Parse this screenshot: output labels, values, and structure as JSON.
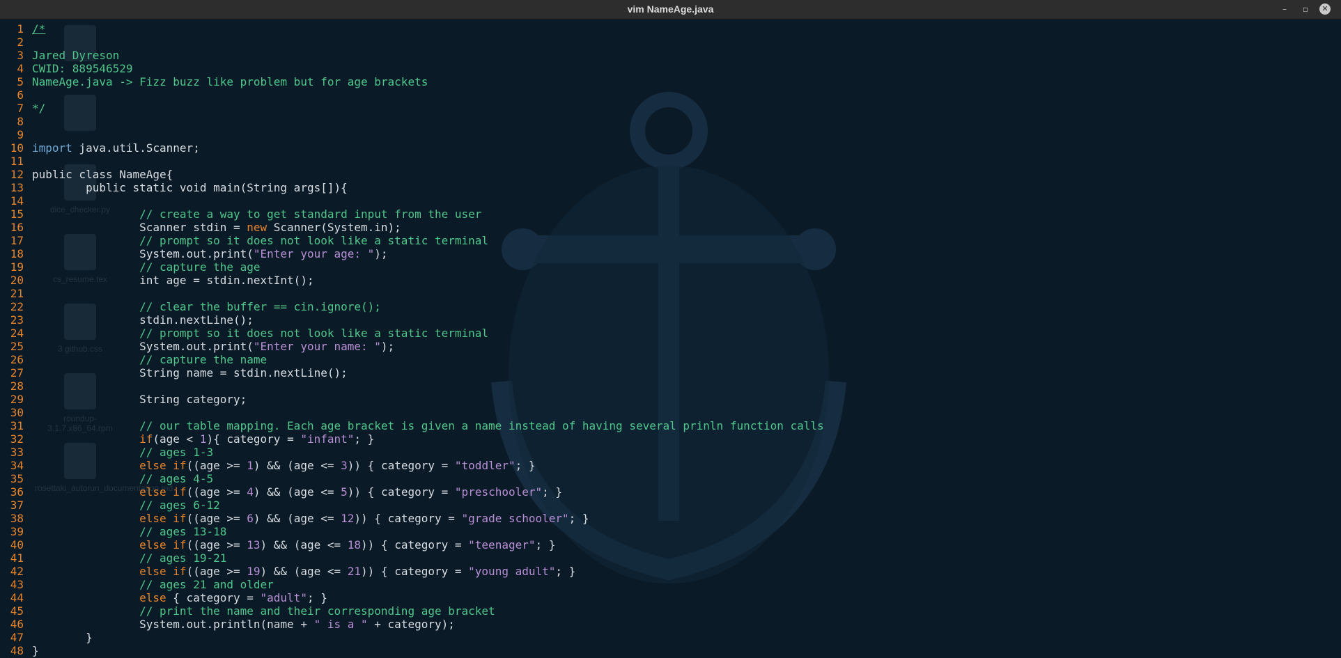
{
  "window": {
    "title": "vim NameAge.java",
    "controls": {
      "minimize": "–",
      "maximize": "▫",
      "close": "✕"
    }
  },
  "desktop_ghost_icons": [
    {
      "label": ""
    },
    {
      "label": ""
    },
    {
      "label": "dice_checker.py"
    },
    {
      "label": "cs_resume.tex"
    },
    {
      "label": "3 github.css"
    },
    {
      "label": "roundup-3.1.7.x86_64.rpm"
    },
    {
      "label": "rosettaki_autorun_documentation.md"
    }
  ],
  "colors": {
    "background": "#0b1a27",
    "line_number": "#e8852a",
    "comment": "#50c78a",
    "keyword": "#e8852a",
    "string": "#b98fd6",
    "text": "#d8dde2"
  },
  "code": [
    {
      "n": "1",
      "t": [
        [
          "c",
          "/*"
        ]
      ]
    },
    {
      "n": "2",
      "t": []
    },
    {
      "n": "3",
      "t": [
        [
          "c",
          "Jared Dyreson"
        ]
      ]
    },
    {
      "n": "4",
      "t": [
        [
          "c",
          "CWID: 889546529"
        ]
      ]
    },
    {
      "n": "5",
      "t": [
        [
          "c",
          "NameAge.java -> Fizz buzz like problem but for age brackets"
        ]
      ]
    },
    {
      "n": "6",
      "t": []
    },
    {
      "n": "7",
      "t": [
        [
          "c",
          "*/"
        ]
      ]
    },
    {
      "n": "8",
      "t": []
    },
    {
      "n": "9",
      "t": []
    },
    {
      "n": "10",
      "t": [
        [
          "imp",
          "import"
        ],
        [
          "src",
          " java.util.Scanner;"
        ]
      ]
    },
    {
      "n": "11",
      "t": []
    },
    {
      "n": "12",
      "t": [
        [
          "src",
          "public class NameAge{"
        ]
      ]
    },
    {
      "n": "13",
      "t": [
        [
          "src",
          "        public static void main(String args[]){"
        ]
      ]
    },
    {
      "n": "14",
      "t": []
    },
    {
      "n": "15",
      "t": [
        [
          "c",
          "                // create a way to get standard input from the user"
        ]
      ]
    },
    {
      "n": "16",
      "t": [
        [
          "src",
          "                Scanner stdin = "
        ],
        [
          "kw",
          "new"
        ],
        [
          "src",
          " Scanner(System.in);"
        ]
      ]
    },
    {
      "n": "17",
      "t": [
        [
          "c",
          "                // prompt so it does not look like a static terminal"
        ]
      ]
    },
    {
      "n": "18",
      "t": [
        [
          "src",
          "                System.out.print("
        ],
        [
          "s",
          "\"Enter your age: \""
        ],
        [
          "src",
          ");"
        ]
      ]
    },
    {
      "n": "19",
      "t": [
        [
          "c",
          "                // capture the age"
        ]
      ]
    },
    {
      "n": "20",
      "t": [
        [
          "src",
          "                int age = stdin.nextInt();"
        ]
      ]
    },
    {
      "n": "21",
      "t": []
    },
    {
      "n": "22",
      "t": [
        [
          "c",
          "                // clear the buffer == cin.ignore();"
        ]
      ]
    },
    {
      "n": "23",
      "t": [
        [
          "src",
          "                stdin.nextLine();"
        ]
      ]
    },
    {
      "n": "24",
      "t": [
        [
          "c",
          "                // prompt so it does not look like a static terminal"
        ]
      ]
    },
    {
      "n": "25",
      "t": [
        [
          "src",
          "                System.out.print("
        ],
        [
          "s",
          "\"Enter your name: \""
        ],
        [
          "src",
          ");"
        ]
      ]
    },
    {
      "n": "26",
      "t": [
        [
          "c",
          "                // capture the name"
        ]
      ]
    },
    {
      "n": "27",
      "t": [
        [
          "src",
          "                String name = stdin.nextLine();"
        ]
      ]
    },
    {
      "n": "28",
      "t": []
    },
    {
      "n": "29",
      "t": [
        [
          "src",
          "                String category;"
        ]
      ]
    },
    {
      "n": "30",
      "t": []
    },
    {
      "n": "31",
      "t": [
        [
          "c",
          "                // our table mapping. Each age bracket is given a name instead of having several prinln function calls"
        ]
      ]
    },
    {
      "n": "32",
      "t": [
        [
          "src",
          "                "
        ],
        [
          "kw",
          "if"
        ],
        [
          "src",
          "(age < "
        ],
        [
          "n",
          "1"
        ],
        [
          "src",
          "){ category = "
        ],
        [
          "s",
          "\"infant\""
        ],
        [
          "src",
          "; }"
        ]
      ]
    },
    {
      "n": "33",
      "t": [
        [
          "c",
          "                // ages 1-3"
        ]
      ]
    },
    {
      "n": "34",
      "t": [
        [
          "src",
          "                "
        ],
        [
          "kw",
          "else if"
        ],
        [
          "src",
          "((age >= "
        ],
        [
          "n",
          "1"
        ],
        [
          "src",
          ") && (age <= "
        ],
        [
          "n",
          "3"
        ],
        [
          "src",
          ")) { category = "
        ],
        [
          "s",
          "\"toddler\""
        ],
        [
          "src",
          "; }"
        ]
      ]
    },
    {
      "n": "35",
      "t": [
        [
          "c",
          "                // ages 4-5"
        ]
      ]
    },
    {
      "n": "36",
      "t": [
        [
          "src",
          "                "
        ],
        [
          "kw",
          "else if"
        ],
        [
          "src",
          "((age >= "
        ],
        [
          "n",
          "4"
        ],
        [
          "src",
          ") && (age <= "
        ],
        [
          "n",
          "5"
        ],
        [
          "src",
          ")) { category = "
        ],
        [
          "s",
          "\"preschooler\""
        ],
        [
          "src",
          "; }"
        ]
      ]
    },
    {
      "n": "37",
      "t": [
        [
          "c",
          "                // ages 6-12"
        ]
      ]
    },
    {
      "n": "38",
      "t": [
        [
          "src",
          "                "
        ],
        [
          "kw",
          "else if"
        ],
        [
          "src",
          "((age >= "
        ],
        [
          "n",
          "6"
        ],
        [
          "src",
          ") && (age <= "
        ],
        [
          "n",
          "12"
        ],
        [
          "src",
          ")) { category = "
        ],
        [
          "s",
          "\"grade schooler\""
        ],
        [
          "src",
          "; }"
        ]
      ]
    },
    {
      "n": "39",
      "t": [
        [
          "c",
          "                // ages 13-18"
        ]
      ]
    },
    {
      "n": "40",
      "t": [
        [
          "src",
          "                "
        ],
        [
          "kw",
          "else if"
        ],
        [
          "src",
          "((age >= "
        ],
        [
          "n",
          "13"
        ],
        [
          "src",
          ") && (age <= "
        ],
        [
          "n",
          "18"
        ],
        [
          "src",
          ")) { category = "
        ],
        [
          "s",
          "\"teenager\""
        ],
        [
          "src",
          "; }"
        ]
      ]
    },
    {
      "n": "41",
      "t": [
        [
          "c",
          "                // ages 19-21"
        ]
      ]
    },
    {
      "n": "42",
      "t": [
        [
          "src",
          "                "
        ],
        [
          "kw",
          "else if"
        ],
        [
          "src",
          "((age >= "
        ],
        [
          "n",
          "19"
        ],
        [
          "src",
          ") && (age <= "
        ],
        [
          "n",
          "21"
        ],
        [
          "src",
          ")) { category = "
        ],
        [
          "s",
          "\"young adult\""
        ],
        [
          "src",
          "; }"
        ]
      ]
    },
    {
      "n": "43",
      "t": [
        [
          "c",
          "                // ages 21 and older"
        ]
      ]
    },
    {
      "n": "44",
      "t": [
        [
          "src",
          "                "
        ],
        [
          "kw",
          "else"
        ],
        [
          "src",
          " { category = "
        ],
        [
          "s",
          "\"adult\""
        ],
        [
          "src",
          "; }"
        ]
      ]
    },
    {
      "n": "45",
      "t": [
        [
          "c",
          "                // print the name and their corresponding age bracket"
        ]
      ]
    },
    {
      "n": "46",
      "t": [
        [
          "src",
          "                System.out.println(name + "
        ],
        [
          "s",
          "\" is a \""
        ],
        [
          "src",
          " + category);"
        ]
      ]
    },
    {
      "n": "47",
      "t": [
        [
          "src",
          "        }"
        ]
      ]
    },
    {
      "n": "48",
      "t": [
        [
          "src",
          "}"
        ]
      ]
    }
  ]
}
